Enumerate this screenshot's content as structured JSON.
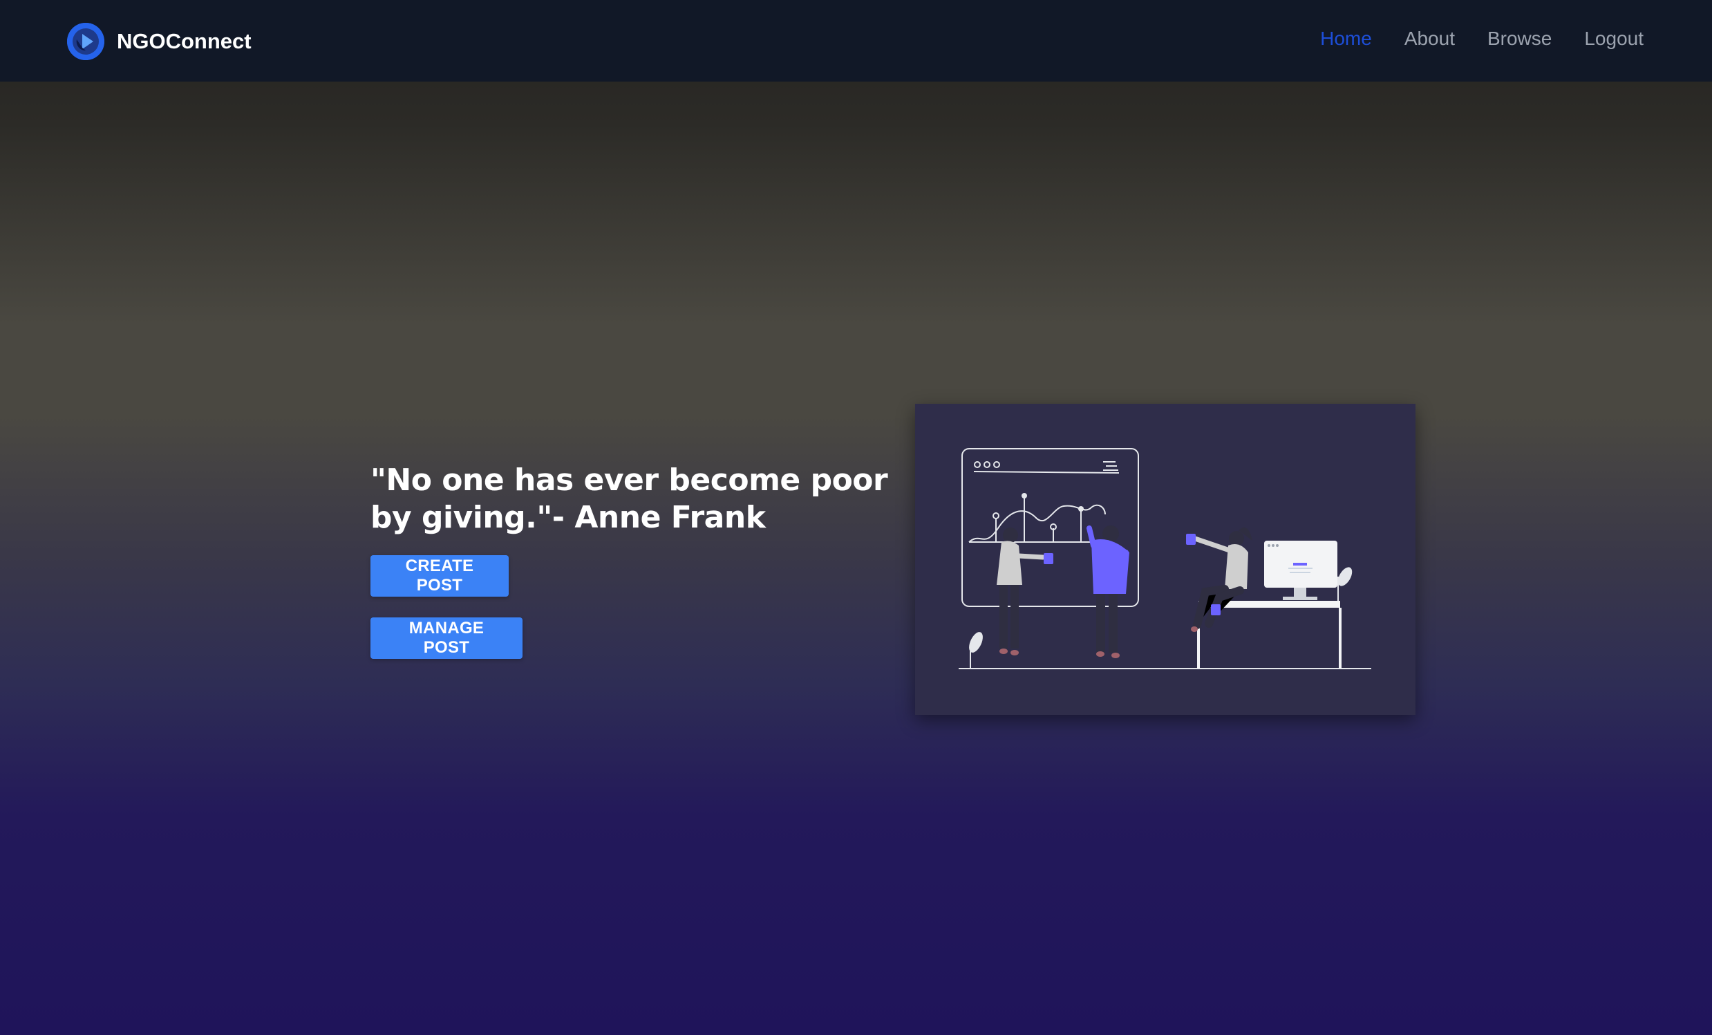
{
  "navbar": {
    "brand_name": "NGOConnect",
    "links": [
      {
        "label": "Home",
        "active": true
      },
      {
        "label": "About",
        "active": false
      },
      {
        "label": "Browse",
        "active": false
      },
      {
        "label": "Logout",
        "active": false
      }
    ]
  },
  "hero": {
    "quote": "\"No one has ever become poor by giving.\"- Anne Frank",
    "create_post_label": "CREATE POST",
    "manage_post_label": "MANAGE POST"
  },
  "colors": {
    "accent": "#3b82f6",
    "nav_active": "#1d4ed8",
    "navbar_bg": "#111827",
    "illustration_purple": "#6c63ff"
  },
  "icons": {
    "logo": "brand-logo-icon",
    "illustration": "team-collaboration-illustration"
  }
}
